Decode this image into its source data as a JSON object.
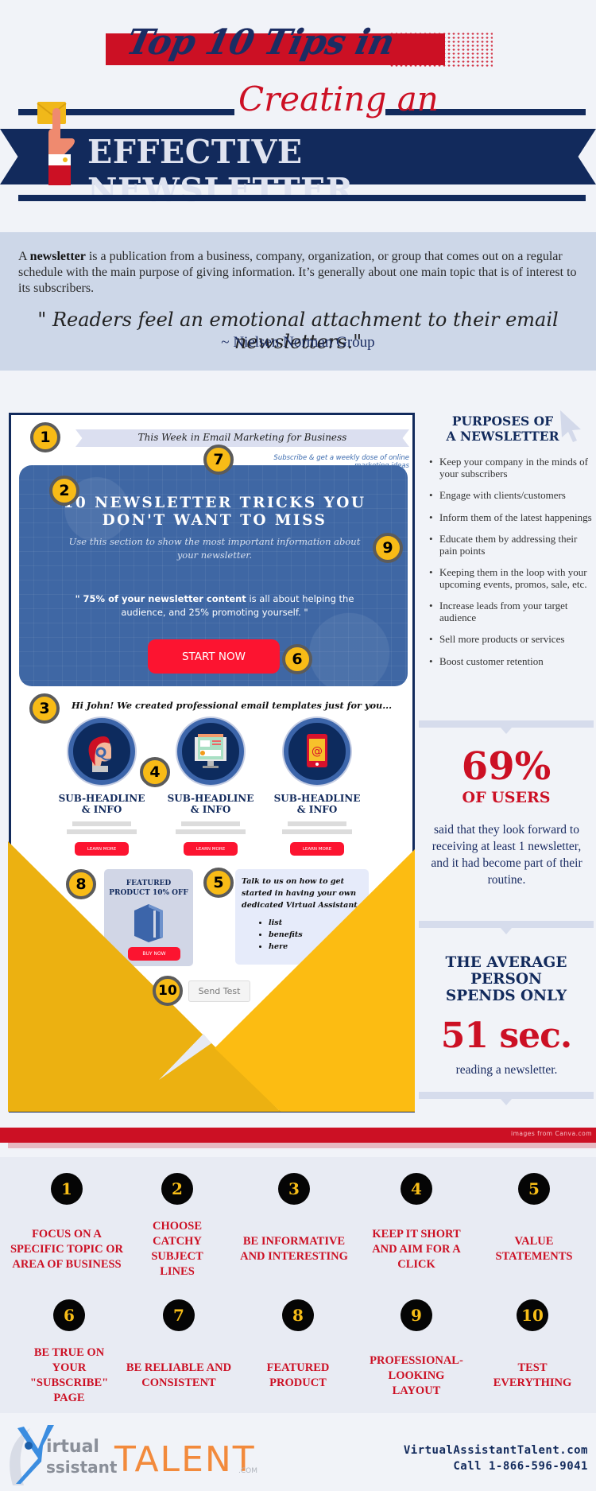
{
  "header": {
    "script_title": "Top 10 Tips in",
    "script_subtitle": "Creating an",
    "ribbon_title": "EFFECTIVE NEWSLETTER",
    "icon": "hand-envelope-icon"
  },
  "intro": {
    "lead_word": "newsletter",
    "text_before": "A ",
    "text_after": " is a publication from a business, company, organization, or group that comes out on a regular schedule with the main purpose of giving information. It’s generally about one main topic that is of interest to its subscribers.",
    "quote": "\" Readers feel an emotional attachment to their email newsletters.\"",
    "quote_author": "~ Nielsen Norman Group"
  },
  "mockup": {
    "markers": [
      "1",
      "2",
      "3",
      "4",
      "5",
      "6",
      "7",
      "8",
      "9",
      "10"
    ],
    "banner": "This Week in Email Marketing for Business",
    "subscribe": "Subscribe & get a weekly dose of online marketing ideas",
    "hero": {
      "title_line1": "10 NEWSLETTER TRICKS YOU",
      "title_line2": "DON'T WANT TO MISS",
      "subtitle": "Use this section to show the most important information about your newsletter.",
      "quote_bold": "\" 75% of your newsletter content",
      "quote_rest": " is all about helping the audience, and 25% promoting yourself. \"",
      "cta": "START NOW"
    },
    "greeting": "Hi John! We created professional email templates just for you...",
    "features": [
      {
        "icon": "headset-agent-icon",
        "line1": "SUB-HEADLINE",
        "line2": "& INFO",
        "button": "LEARN MORE"
      },
      {
        "icon": "desktop-monitor-icon",
        "line1": "SUB-HEADLINE",
        "line2": "& INFO",
        "button": "LEARN MORE"
      },
      {
        "icon": "tablet-email-icon",
        "line1": "SUB-HEADLINE",
        "line2": "& INFO",
        "button": "LEARN MORE"
      }
    ],
    "featured_product": {
      "line1": "FEATURED",
      "line2": "PRODUCT 10% OFF",
      "icon": "book-icon",
      "button": "BUY NOW"
    },
    "talk": {
      "text": "Talk to us on how to get started in having your own dedicated Virtual Assistant.",
      "list": [
        "list",
        "benefits",
        "here"
      ]
    },
    "send_test": "Send Test"
  },
  "sidebar": {
    "title_line1": "PURPOSES OF",
    "title_line2": "A NEWSLETTER",
    "purposes": [
      "Keep your company in the minds of your subscribers",
      "Engage with clients/customers",
      "Inform them of the latest happenings",
      "Educate them by addressing their pain points",
      "Keeping them in the loop with your upcoming events, promos, sale, etc.",
      "Increase leads from your target audience",
      "Sell more products or services",
      "Boost customer retention"
    ],
    "stat1": {
      "value": "69%",
      "label": "OF USERS",
      "desc": "said that they look forward to receiving at least 1 newsletter, and it had become part of their routine."
    },
    "stat2": {
      "head_line1": "THE AVERAGE",
      "head_line2": "PERSON",
      "head_line3": "SPENDS ONLY",
      "value": "51 sec.",
      "desc": "reading a newsletter."
    }
  },
  "credit": "images from Canva.com",
  "tips": [
    {
      "num": "1",
      "label": "FOCUS ON A SPECIFIC TOPIC OR AREA OF BUSINESS"
    },
    {
      "num": "2",
      "label": "CHOOSE CATCHY SUBJECT LINES"
    },
    {
      "num": "3",
      "label": "BE INFORMATIVE AND INTERESTING"
    },
    {
      "num": "4",
      "label": "KEEP IT SHORT AND AIM FOR A CLICK"
    },
    {
      "num": "5",
      "label": "VALUE STATEMENTS"
    },
    {
      "num": "6",
      "label": "BE TRUE ON YOUR \"SUBSCRIBE\" PAGE"
    },
    {
      "num": "7",
      "label": "BE RELIABLE AND CONSISTENT"
    },
    {
      "num": "8",
      "label": "FEATURED PRODUCT"
    },
    {
      "num": "9",
      "label": "PROFESSIONAL-LOOKING LAYOUT"
    },
    {
      "num": "10",
      "label": "TEST EVERYTHING"
    }
  ],
  "footer": {
    "logo_virtual": "irtual",
    "logo_assistant": "ssistant",
    "logo_talent": "TALENT",
    "logo_com": ".COM",
    "website": "VirtualAssistantTalent.com",
    "phone": "Call 1-866-596-9041"
  },
  "colors": {
    "navy": "#122a5c",
    "red": "#cc1024",
    "yellow": "#f8bb16",
    "button_red": "#fc1430",
    "intro_bg": "#cdd7e8",
    "page_bg": "#f1f3f8"
  }
}
